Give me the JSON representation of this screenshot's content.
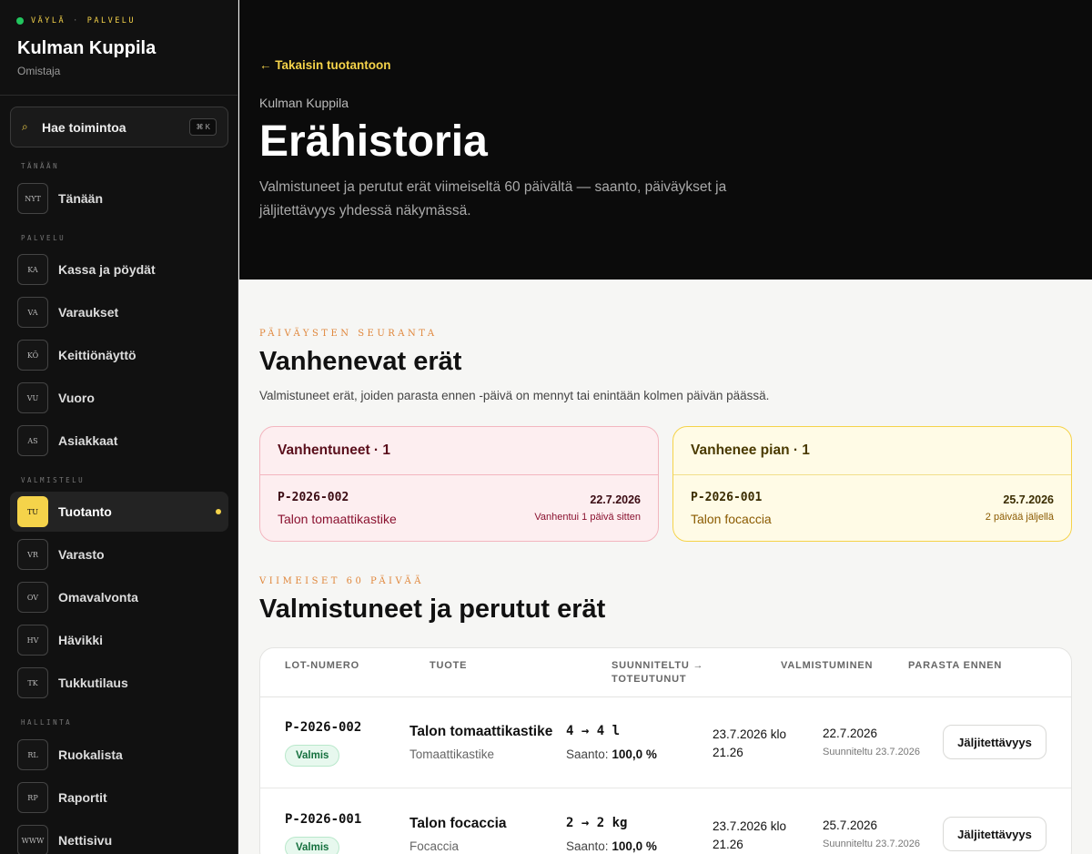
{
  "sidebar": {
    "brand": {
      "part1": "VÄYLÄ",
      "separator": "·",
      "part2": "PALVELU"
    },
    "workspace_name": "Kulman Kuppila",
    "role": "Omistaja",
    "search": {
      "label": "Hae toimintoa",
      "shortcut": "⌘ K",
      "icon": "search-icon"
    },
    "groups": [
      {
        "label": "TÄNÄÄN",
        "items": [
          {
            "code": "NYT",
            "label": "Tänään"
          }
        ]
      },
      {
        "label": "PALVELU",
        "items": [
          {
            "code": "KA",
            "label": "Kassa ja pöydät"
          },
          {
            "code": "VA",
            "label": "Varaukset"
          },
          {
            "code": "KÖ",
            "label": "Keittiönäyttö"
          },
          {
            "code": "VU",
            "label": "Vuoro"
          },
          {
            "code": "AS",
            "label": "Asiakkaat"
          }
        ]
      },
      {
        "label": "VALMISTELU",
        "items": [
          {
            "code": "TU",
            "label": "Tuotanto",
            "active": true
          },
          {
            "code": "VR",
            "label": "Varasto"
          },
          {
            "code": "OV",
            "label": "Omavalvonta"
          },
          {
            "code": "HV",
            "label": "Hävikki"
          },
          {
            "code": "TK",
            "label": "Tukkutilaus"
          }
        ]
      },
      {
        "label": "HALLINTA",
        "items": [
          {
            "code": "RL",
            "label": "Ruokalista"
          },
          {
            "code": "RP",
            "label": "Raportit"
          },
          {
            "code": "WWW",
            "label": "Nettisivu"
          }
        ]
      }
    ],
    "accent_color": "#f5d34a"
  },
  "header": {
    "back_link": "← Takaisin tuotantoon",
    "breadcrumb": "Kulman Kuppila",
    "title": "Erähistoria",
    "description": "Valmistuneet ja perutut erät viimeiseltä 60 päivältä — saanto, päiväykset ja jäljitettävyys yhdessä näkymässä."
  },
  "expiring": {
    "eyebrow": "PÄIVÄYSTEN SEURANTA",
    "title": "Vanhenevat erät",
    "subtitle": "Valmistuneet erät, joiden parasta ennen -päivä on mennyt tai enintään kolmen päivän päässä.",
    "expired": {
      "header": "Vanhentuneet · 1",
      "lot": "P-2026-002",
      "product": "Talon tomaattikastike",
      "date": "22.7.2026",
      "note": "Vanhentui 1 päivä sitten"
    },
    "soon": {
      "header": "Vanhenee pian · 1",
      "lot": "P-2026-001",
      "product": "Talon focaccia",
      "date": "25.7.2026",
      "note": "2 päivää jäljellä"
    }
  },
  "history": {
    "eyebrow": "VIIMEISET 60 PÄIVÄÄ",
    "title": "Valmistuneet ja perutut erät",
    "columns": {
      "lot": "LOT-NUMERO",
      "product": "TUOTE",
      "planned": "SUUNNITELTU →",
      "planned2": "TOTEUTUNUT",
      "completed": "VALMISTUMINEN",
      "best_before": "PARASTA ENNEN"
    },
    "rows": [
      {
        "lot": "P-2026-002",
        "status": "Valmis",
        "product": "Talon tomaattikastike",
        "category": "Tomaattikastike",
        "quantity": "4 → 4 l",
        "yield_label": "Saanto:",
        "yield_value": "100,0 %",
        "completed": "23.7.2026 klo 21.26",
        "best_before": "22.7.2026",
        "planned_date": "Suunniteltu 23.7.2026",
        "action": "Jäljitettävyys"
      },
      {
        "lot": "P-2026-001",
        "status": "Valmis",
        "product": "Talon focaccia",
        "category": "Focaccia",
        "quantity": "2 → 2 kg",
        "yield_label": "Saanto:",
        "yield_value": "100,0 %",
        "completed": "23.7.2026 klo 21.26",
        "best_before": "25.7.2026",
        "planned_date": "Suunniteltu 23.7.2026",
        "action": "Jäljitettävyys"
      }
    ]
  }
}
